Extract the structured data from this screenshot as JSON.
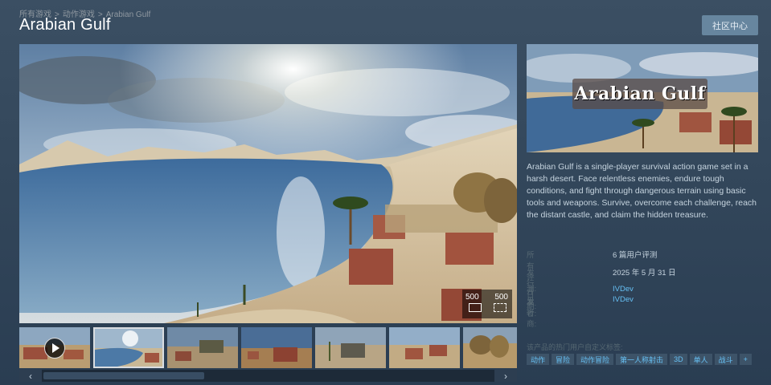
{
  "breadcrumb": [
    "所有游戏",
    "动作游戏",
    "Arabian Gulf"
  ],
  "breadcrumb_sep": ">",
  "title": "Arabian Gulf",
  "community_button": "社区中心",
  "media": {
    "resolution_left": "500",
    "resolution_right": "500"
  },
  "thumbnails_count": 7,
  "selected_thumbnail": 1,
  "capsule_logo": "Arabian Gulf",
  "description": "Arabian Gulf is a single-player survival action game set in a harsh desert. Face relentless enemies, endure tough conditions, and fight through dangerous terrain using basic tools and weapons. Survive, overcome each challenge, reach the distant castle, and claim the hidden treasure.",
  "info": {
    "reviews_label": "所有评测:",
    "reviews_value": "6 篇用户评测",
    "release_label": "发行日期:",
    "release_value": "2025 年 5 月 31 日",
    "developer_label": "开发者:",
    "developer_value": "IVDev",
    "publisher_label": "发行商:",
    "publisher_value": "IVDev"
  },
  "tags_label": "该产品的热门用户自定义标签:",
  "tags": [
    "动作",
    "冒险",
    "动作冒险",
    "第一人称射击",
    "3D",
    "单人",
    "战斗",
    "+"
  ],
  "scroll_left": "‹",
  "scroll_right": "›",
  "colors": {
    "background": "#33475b",
    "accent_link": "#66c0f4",
    "button": "#67869f",
    "tag_bg": "#3d5368"
  }
}
